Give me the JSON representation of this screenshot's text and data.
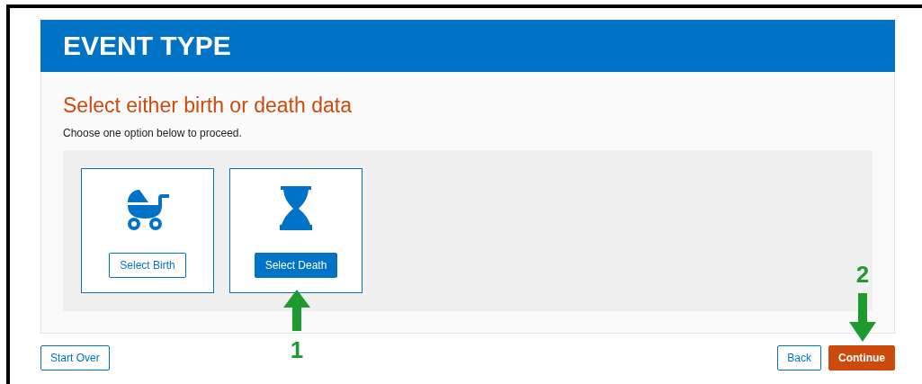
{
  "header": {
    "title": "EVENT TYPE"
  },
  "panel": {
    "heading": "Select either birth or death data",
    "instruction": "Choose one option below to proceed."
  },
  "options": [
    {
      "kind": "birth",
      "button": "Select Birth",
      "selected": false
    },
    {
      "kind": "death",
      "button": "Select Death",
      "selected": true
    }
  ],
  "footer": {
    "start_over": "Start Over",
    "back": "Back",
    "continue": "Continue"
  },
  "annotations": [
    {
      "kind": "up",
      "label": "1"
    },
    {
      "kind": "down",
      "label": "2"
    }
  ]
}
